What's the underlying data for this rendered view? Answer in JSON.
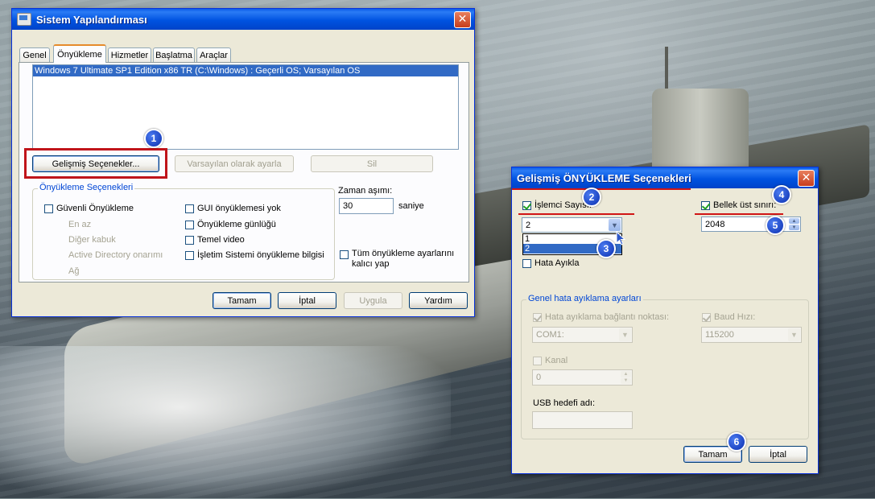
{
  "main_window": {
    "title": "Sistem Yapılandırması",
    "tabs": [
      {
        "label": "Genel"
      },
      {
        "label": "Önyükleme"
      },
      {
        "label": "Hizmetler"
      },
      {
        "label": "Başlatma"
      },
      {
        "label": "Araçlar"
      }
    ],
    "os_list": [
      "Windows 7 Ultimate SP1 Edition x86 TR (C:\\Windows) : Geçerli OS; Varsayılan OS"
    ],
    "buttons": {
      "advanced": "Gelişmiş Seçenekler...",
      "set_default": "Varsayılan olarak ayarla",
      "delete": "Sil"
    },
    "boot_options": {
      "legend": "Önyükleme Seçenekleri",
      "safe_boot": "Güvenli Önyükleme",
      "minimal": "En az",
      "alternate_shell": "Diğer kabuk",
      "active_directory": "Active Directory onarımı",
      "network": "Ağ",
      "no_gui": "GUI önyüklemesi yok",
      "boot_log": "Önyükleme günlüğü",
      "base_video": "Temel video",
      "os_boot_info": "İşletim Sistemi önyükleme bilgisi"
    },
    "timeout": {
      "label": "Zaman aşımı:",
      "value": "30",
      "unit": "saniye"
    },
    "make_permanent": "Tüm önyükleme ayarlarını kalıcı yap",
    "footer": {
      "ok": "Tamam",
      "cancel": "İptal",
      "apply": "Uygula",
      "help": "Yardım"
    }
  },
  "advanced_window": {
    "title": "Gelişmiş ÖNYÜKLEME Seçenekleri",
    "num_processors": {
      "label": "İşlemci Sayısı:",
      "checked": true,
      "value": "2",
      "options": [
        "1",
        "2"
      ]
    },
    "max_memory": {
      "label": "Bellek üst sınırı:",
      "checked": true,
      "value": "2048"
    },
    "debug": {
      "label": "Hata Ayıkla",
      "checked": false
    },
    "global_debug": {
      "legend": "Genel hata ayıklama ayarları",
      "debug_port": {
        "label": "Hata ayıklama bağlantı noktası:",
        "value": "COM1:"
      },
      "baud_rate": {
        "label": "Baud Hızı:",
        "value": "115200"
      },
      "channel": {
        "label": "Kanal",
        "value": "0"
      },
      "usb_target": {
        "label": "USB hedefi adı:",
        "value": ""
      }
    },
    "footer": {
      "ok": "Tamam",
      "cancel": "İptal"
    }
  },
  "annotations": {
    "badges": [
      "1",
      "2",
      "3",
      "4",
      "5",
      "6"
    ],
    "highlight_color": "#c0141a",
    "underline_color": "#d01515"
  }
}
